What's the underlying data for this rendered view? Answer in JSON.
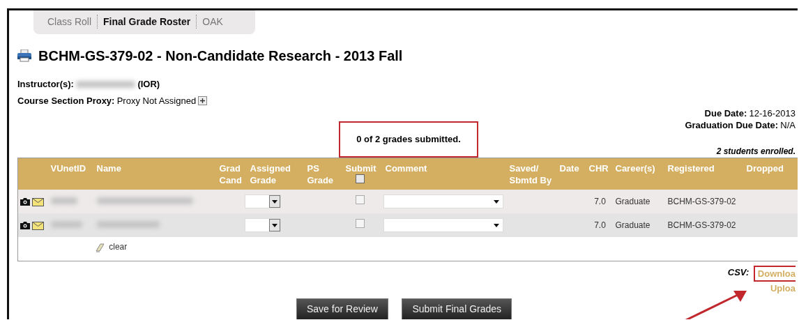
{
  "tabs": [
    {
      "label": "Class Roll",
      "selected": false
    },
    {
      "label": "Final Grade Roster",
      "selected": true
    },
    {
      "label": "OAK",
      "selected": false
    }
  ],
  "course_title": "BCHM-GS-379-02 - Non-Candidate Research - 2013 Fall",
  "instructor": {
    "label": "Instructor(s):",
    "role": "(IOR)"
  },
  "proxy": {
    "label": "Course Section Proxy:",
    "value": "Proxy Not Assigned"
  },
  "due_dates": [
    {
      "label": "Due Date:",
      "value": "12-16-2013"
    },
    {
      "label": "Graduation Due Date:",
      "value": "N/A"
    }
  ],
  "submission_status": "0 of 2 grades submitted.",
  "enrollment": "2 students enrolled.",
  "table": {
    "columns": [
      "VUnetID",
      "Name",
      "Grad Cand",
      "Assigned Grade",
      "PS Grade",
      "Submit",
      "Comment",
      "Saved/ Sbmtd By",
      "Date",
      "CHR",
      "Career(s)",
      "Registered",
      "Dropped"
    ],
    "submit_all_checked": false,
    "rows": [
      {
        "chr": "7.0",
        "career": "Graduate",
        "registered": "BCHM-GS-379-02",
        "submit_checked": false
      },
      {
        "chr": "7.0",
        "career": "Graduate",
        "registered": "BCHM-GS-379-02",
        "submit_checked": false
      }
    ],
    "clear_label": "clear"
  },
  "csv": {
    "label": "CSV:",
    "links": [
      "Downloa",
      "Uploa"
    ]
  },
  "buttons": [
    "Save for Review",
    "Submit Final Grades"
  ]
}
